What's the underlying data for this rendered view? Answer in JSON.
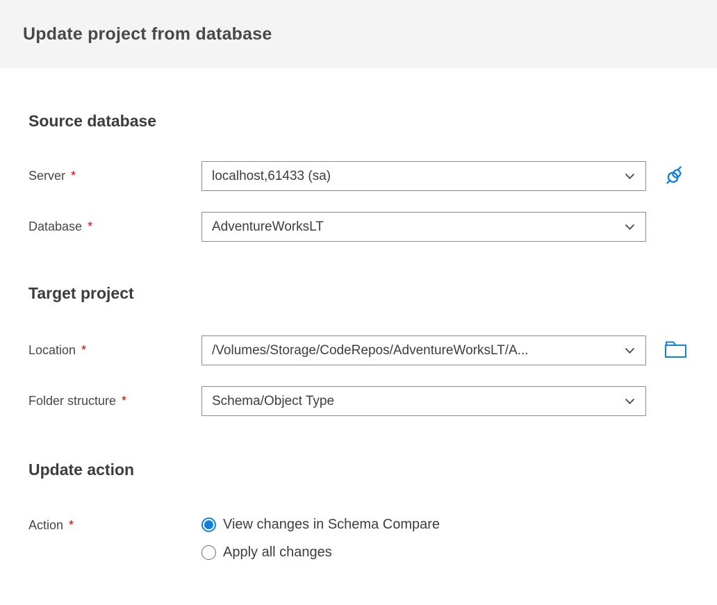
{
  "title": "Update project from database",
  "required_marker": "*",
  "colors": {
    "accent": "#0f80dc",
    "required": "#e00000",
    "header_bg": "#f4f4f4",
    "border": "#8a8a8a",
    "text": "#3f3f3f"
  },
  "icons": {
    "connect": "plug-icon",
    "browse": "folder-icon",
    "dropdown": "chevron-down-icon",
    "radio_selected": "radio-selected-icon",
    "radio_unselected": "radio-unselected-icon"
  },
  "source_database": {
    "heading": "Source database",
    "server": {
      "label": "Server",
      "value": "localhost,61433 (sa)"
    },
    "database": {
      "label": "Database",
      "value": "AdventureWorksLT"
    }
  },
  "target_project": {
    "heading": "Target project",
    "location": {
      "label": "Location",
      "value": "/Volumes/Storage/CodeRepos/AdventureWorksLT/A..."
    },
    "folder_structure": {
      "label": "Folder structure",
      "value": "Schema/Object Type"
    }
  },
  "update_action": {
    "heading": "Update action",
    "action": {
      "label": "Action",
      "options": [
        {
          "label": "View changes in Schema Compare",
          "selected": true
        },
        {
          "label": "Apply all changes",
          "selected": false
        }
      ]
    }
  }
}
